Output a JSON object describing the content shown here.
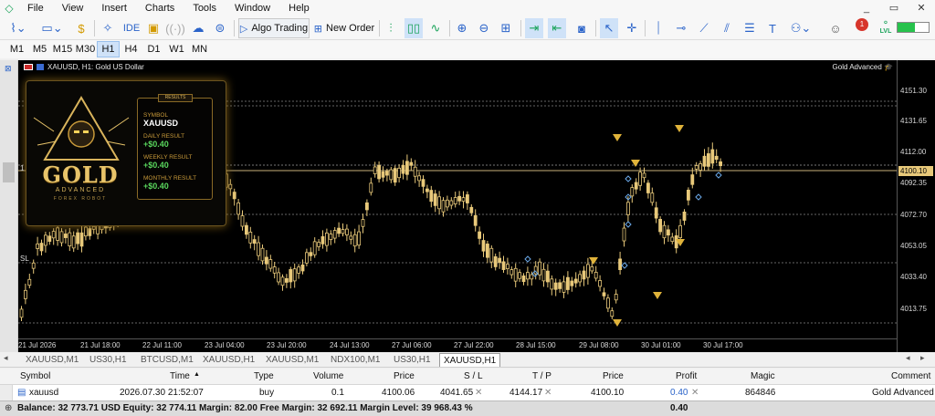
{
  "menu": {
    "items": [
      "File",
      "View",
      "Insert",
      "Charts",
      "Tools",
      "Window",
      "Help"
    ]
  },
  "window_controls": [
    "_",
    "▭",
    "✕"
  ],
  "toolbar": {
    "ide_label": "IDE",
    "algo_trading_label": "Algo Trading",
    "new_order_label": "New Order",
    "lvl_label": "LVL",
    "alert_count": "1"
  },
  "timeframes": [
    "M1",
    "M5",
    "M15",
    "M30",
    "H1",
    "H4",
    "D1",
    "W1",
    "MN"
  ],
  "active_timeframe": "H1",
  "chart": {
    "title": "XAUUSD, H1:  Gold US Dollar",
    "ea_name": "Gold Advanced",
    "left_marker_1": "1",
    "left_marker_2": "SL",
    "price_labels": [
      "4151.30",
      "4131.65",
      "4112.00",
      "4092.35",
      "4072.70",
      "4053.05",
      "4033.40",
      "4013.75"
    ],
    "current_price": "4100.10",
    "time_labels": [
      "21 Jul 2026",
      "21 Jul 18:00",
      "22 Jul 11:00",
      "23 Jul 04:00",
      "23 Jul 20:00",
      "24 Jul 13:00",
      "27 Jul 06:00",
      "27 Jul 22:00",
      "28 Jul 15:00",
      "29 Jul 08:00",
      "30 Jul 01:00",
      "30 Jul 17:00"
    ],
    "candle_color": "#e8c97a"
  },
  "ea_panel": {
    "logo_word": "GOLD",
    "logo_sub": "ADVANCED",
    "logo_tag": "FOREX ROBOT",
    "results_header": "RESULTS",
    "symbol_label": "SYMBOL",
    "symbol_value": "XAUUSD",
    "daily_label": "DAILY RESULT",
    "daily_value": "+$0.40",
    "weekly_label": "WEEKLY RESULT",
    "weekly_value": "+$0.40",
    "monthly_label": "MONTHLY RESULT",
    "monthly_value": "+$0.40"
  },
  "chart_tabs": [
    "XAUUSD,M1",
    "US30,H1",
    "BTCUSD,M1",
    "XAUUSD,H1",
    "XAUUSD,M1",
    "NDX100,M1",
    "US30,H1",
    "XAUUSD,H1"
  ],
  "active_tab_index": 7,
  "trade_grid": {
    "headers": {
      "symbol": "Symbol",
      "time": "Time",
      "type": "Type",
      "volume": "Volume",
      "price": "Price",
      "sl": "S / L",
      "tp": "T / P",
      "cur_price": "Price",
      "profit": "Profit",
      "magic": "Magic",
      "comment": "Comment"
    },
    "row": {
      "symbol": "xauusd",
      "time": "2026.07.30 21:52:07",
      "type": "buy",
      "volume": "0.1",
      "price": "4100.06",
      "sl": "4041.65",
      "tp": "4144.17",
      "cur_price": "4100.10",
      "profit": "0.40",
      "magic": "864846",
      "comment": "Gold Advanced"
    },
    "footer": "Balance: 32 773.71 USD  Equity: 32 774.11  Margin: 82.00  Free Margin: 32 692.11  Margin Level: 39 968.43 %",
    "footer_profit": "0.40"
  }
}
